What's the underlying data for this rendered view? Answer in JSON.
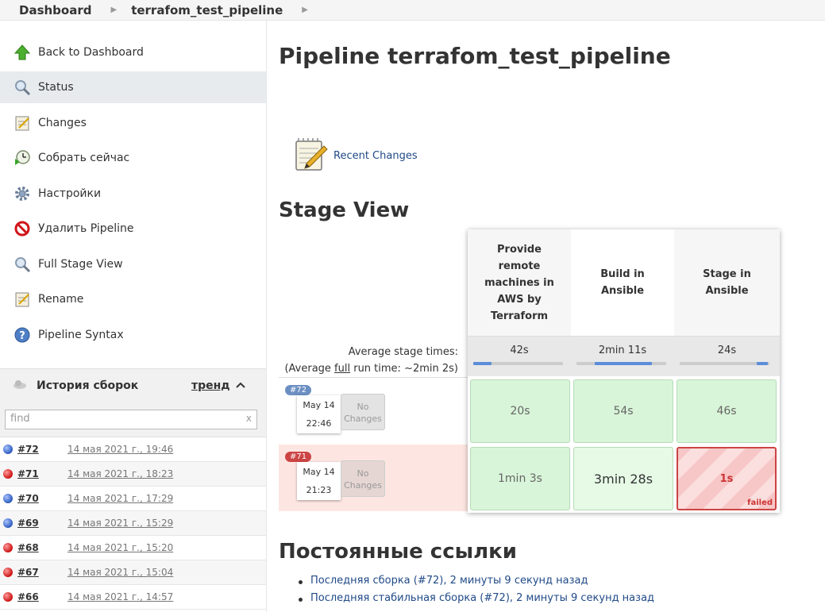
{
  "breadcrumb": {
    "dashboard": "Dashboard",
    "job": "terrafom_test_pipeline"
  },
  "sidebar": {
    "tasks": [
      {
        "label": "Back to Dashboard",
        "icon": "up-arrow-icon"
      },
      {
        "label": "Status",
        "icon": "magnifier-icon"
      },
      {
        "label": "Changes",
        "icon": "notepad-icon"
      },
      {
        "label": "Собрать сейчас",
        "icon": "clock-icon"
      },
      {
        "label": "Настройки",
        "icon": "gear-icon"
      },
      {
        "label": "Удалить Pipeline",
        "icon": "no-entry-icon"
      },
      {
        "label": "Full Stage View",
        "icon": "magnifier-icon"
      },
      {
        "label": "Rename",
        "icon": "notepad-icon"
      },
      {
        "label": "Pipeline Syntax",
        "icon": "help-icon"
      }
    ],
    "build_history": {
      "title": "История сборок",
      "trend": "тренд",
      "find_placeholder": "find",
      "find_clear": "x",
      "builds": [
        {
          "num": "#72",
          "date": "14 мая 2021 г., 19:46",
          "status": "blue"
        },
        {
          "num": "#71",
          "date": "14 мая 2021 г., 18:23",
          "status": "red"
        },
        {
          "num": "#70",
          "date": "14 мая 2021 г., 17:29",
          "status": "blue"
        },
        {
          "num": "#69",
          "date": "14 мая 2021 г., 15:29",
          "status": "blue"
        },
        {
          "num": "#68",
          "date": "14 мая 2021 г., 15:20",
          "status": "red"
        },
        {
          "num": "#67",
          "date": "14 мая 2021 г., 15:04",
          "status": "red"
        },
        {
          "num": "#66",
          "date": "14 мая 2021 г., 14:57",
          "status": "red"
        }
      ]
    }
  },
  "main": {
    "title": "Pipeline terrafom_test_pipeline",
    "recent_changes": "Recent Changes",
    "stage_view_title": "Stage View",
    "avg_stage_label": "Average stage times:",
    "avg_run_prefix": "(Average ",
    "avg_run_link": "full",
    "avg_run_suffix": " run time: ~2min 2s)",
    "stages": [
      {
        "name": "Provide remote machines in AWS by Terraform",
        "avg": "42s",
        "bar_start": 0.0,
        "bar_fill": 0.2
      },
      {
        "name": "Build in Ansible",
        "avg": "2min 11s",
        "bar_start": 0.2,
        "bar_fill": 0.64
      },
      {
        "name": "Stage in Ansible",
        "avg": "24s",
        "bar_start": 0.86,
        "bar_fill": 0.12
      }
    ],
    "runs": [
      {
        "badge": "#72",
        "date": "May 14",
        "time": "22:46",
        "changes": "No Changes",
        "status": "ok",
        "cells": [
          "20s",
          "54s",
          "46s"
        ]
      },
      {
        "badge": "#71",
        "date": "May 14",
        "time": "21:23",
        "changes": "No Changes",
        "status": "bad",
        "cells": [
          "1min 3s",
          "3min 28s",
          "1s"
        ],
        "failed_label": "failed"
      }
    ],
    "permalinks_title": "Постоянные ссылки",
    "permalinks": [
      "Последняя сборка (#72), 2 минуты 9 секунд назад",
      "Последняя стабильная сборка (#72), 2 минуты 9 секунд назад"
    ]
  }
}
